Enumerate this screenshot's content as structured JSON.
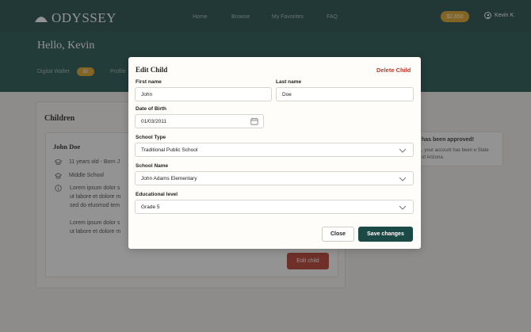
{
  "brand": {
    "name": "ODYSSEY"
  },
  "nav": {
    "home": "Home",
    "browse": "Browse",
    "favorites": "My Favorites",
    "faq": "FAQ"
  },
  "header": {
    "wallet_amount": "$2,650",
    "user_name": "Kevin K."
  },
  "hero": {
    "greeting": "Hello, Kevin",
    "wallet_tab": "Digital Wallet",
    "wallet_badge": "$0",
    "profile_tab": "Profile"
  },
  "children_section": {
    "title": "Children",
    "child": {
      "name": "John Doe",
      "age_line": "11 years old - Born J",
      "school_line": "Middle School",
      "para1": [
        "Lorem ipsum dolor s",
        "ut labore et dolore m",
        "sed do elusmod tem"
      ],
      "para2": [
        "Lorem ipsum dolor s",
        "ut labore et dolore m"
      ],
      "edit_button": "Edit child"
    }
  },
  "notice": {
    "title": "has been approved!",
    "text": ", your account has been e State of Arizona."
  },
  "modal": {
    "title": "Edit Child",
    "delete_label": "Delete Child",
    "first_name_label": "First name",
    "first_name_value": "John",
    "last_name_label": "Last name",
    "last_name_value": "Doe",
    "dob_label": "Date of Birth",
    "dob_value": "01/03/2011",
    "school_type_label": "School Type",
    "school_type_value": "Traditional Public School",
    "school_name_label": "School Name",
    "school_name_value": "John Adams Elementary",
    "edu_level_label": "Educational level",
    "edu_level_value": "Grade 5",
    "close_label": "Close",
    "save_label": "Save changes"
  },
  "colors": {
    "brand": "#1b4946",
    "accent": "#e0a020",
    "danger": "#c0392b"
  },
  "icons": [
    "logo-icon",
    "user-icon",
    "cap-icon",
    "school-icon",
    "info-icon",
    "calendar-icon",
    "chevron-down-icon"
  ]
}
